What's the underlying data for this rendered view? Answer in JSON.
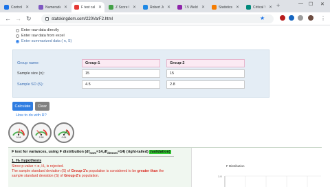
{
  "browser": {
    "tabs": [
      {
        "title": "Control",
        "color": "#1a73e8"
      },
      {
        "title": "Numerade",
        "color": "#7e57c2"
      },
      {
        "title": "F test calcu",
        "color": "#e53935",
        "active": true
      },
      {
        "title": "Z Score Ca",
        "color": "#43a047"
      },
      {
        "title": "Robert Joh",
        "color": "#1e88e5"
      },
      {
        "title": "7.5 Welch t",
        "color": "#8e24aa"
      },
      {
        "title": "Statistics 31",
        "color": "#f57c00"
      },
      {
        "title": "Critical Valu",
        "color": "#00897b"
      }
    ],
    "url": "statskingdom.com/220VarF2.html"
  },
  "input_options": [
    {
      "label": "Enter raw data directly",
      "selected": false
    },
    {
      "label": "Enter raw data from excel",
      "selected": false
    },
    {
      "label": "Enter summarized data ( n, S)",
      "selected": true
    }
  ],
  "form": {
    "group_name_label": "Group name:",
    "sample_size_label": "Sample size (n):",
    "sample_sd_label": "Sample SD (S):",
    "group1": {
      "name": "Group-1",
      "n": "15",
      "sd": "4.5"
    },
    "group2": {
      "name": "Group-2",
      "n": "15",
      "sd": "2.8"
    }
  },
  "buttons": {
    "calculate": "Calculate",
    "clear": "Clear"
  },
  "how_to_link": "How to do with R?",
  "gauges": [
    {
      "value": "0.04",
      "level": 0.55,
      "color": "#e53935"
    },
    {
      "value": "2.58",
      "level": 0.25,
      "color": "#e53935"
    },
    {
      "value": "0.64",
      "level": 0.72,
      "color": "#2e7d32"
    }
  ],
  "results": {
    "title_a": "F test for variances, using F distribution (df",
    "title_sub1": "nom",
    "title_b": "=14,df",
    "title_sub2": "denom",
    "title_c": "=14) (right-tailed) ",
    "title_badge": "(validation)",
    "section_heading": "1. H₀ hypothesis",
    "line1": "Since p-value < α, H₀ is rejected.",
    "line2_a": "The sample standard deviation (S) of ",
    "line2_b": "Group-1's",
    "line2_c": " population is considered to be ",
    "line2_d": "greater than",
    "line2_e": " the",
    "line3_a": "sample standard deviation (S) of ",
    "line3_b": "Group-2's",
    "line3_c": " population."
  },
  "chart_data": {
    "type": "line",
    "title": "F Distribution",
    "ytick_labels": [
      "1.0"
    ]
  }
}
